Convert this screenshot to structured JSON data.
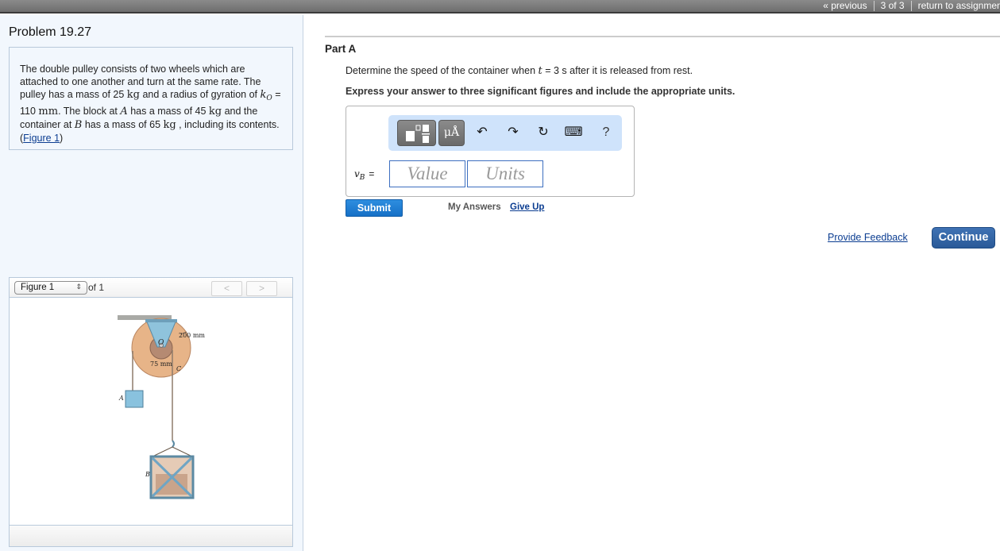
{
  "topbar": {
    "previous": "« previous",
    "position": "3 of 3",
    "return": "return to assignment"
  },
  "problem": {
    "title": "Problem 19.27",
    "text": {
      "p1": "The double pulley consists of two wheels which are attached to one another and turn at the same rate. The pulley has a mass of 25 ",
      "kg": "kg",
      "p2": " and a radius of gyration of ",
      "k": "k",
      "k_sub": "O",
      "p3": " = 110 ",
      "mm": "mm",
      "p4": ". The block at ",
      "A": "A",
      "p5": " has a mass of 45 ",
      "p6": "and the container at ",
      "B": "B",
      "p7": " has a mass of 65 ",
      "p8": " , including its contents. (",
      "figure_link": "Figure 1",
      "p9": ")"
    }
  },
  "figure": {
    "selected": "Figure 1",
    "select_arrows": "⇕",
    "of_label": "of 1",
    "prev": "<",
    "next": ">",
    "labels": {
      "outer_radius": "200 mm",
      "inner_radius": "75 mm",
      "center": "O",
      "point_c": "C",
      "block_a": "A",
      "container_b": "B"
    }
  },
  "part": {
    "title": "Part A",
    "question_pre": "Determine the speed of the container when ",
    "question_var": "t",
    "question_post": " = 3  s after it is released from rest.",
    "instruction": "Express your answer to three significant figures and include the appropriate units."
  },
  "answer": {
    "toolbar": {
      "units_label": "μÅ",
      "undo": "↶",
      "redo": "↷",
      "reset": "↻",
      "keyboard": "⌨",
      "help": "?"
    },
    "variable": "v",
    "variable_sub": "B",
    "equals": "=",
    "value_placeholder": "Value",
    "units_placeholder": "Units"
  },
  "actions": {
    "submit": "Submit",
    "my_answers": "My Answers",
    "give_up": "Give Up",
    "provide_feedback": "Provide Feedback",
    "continue": "Continue"
  }
}
